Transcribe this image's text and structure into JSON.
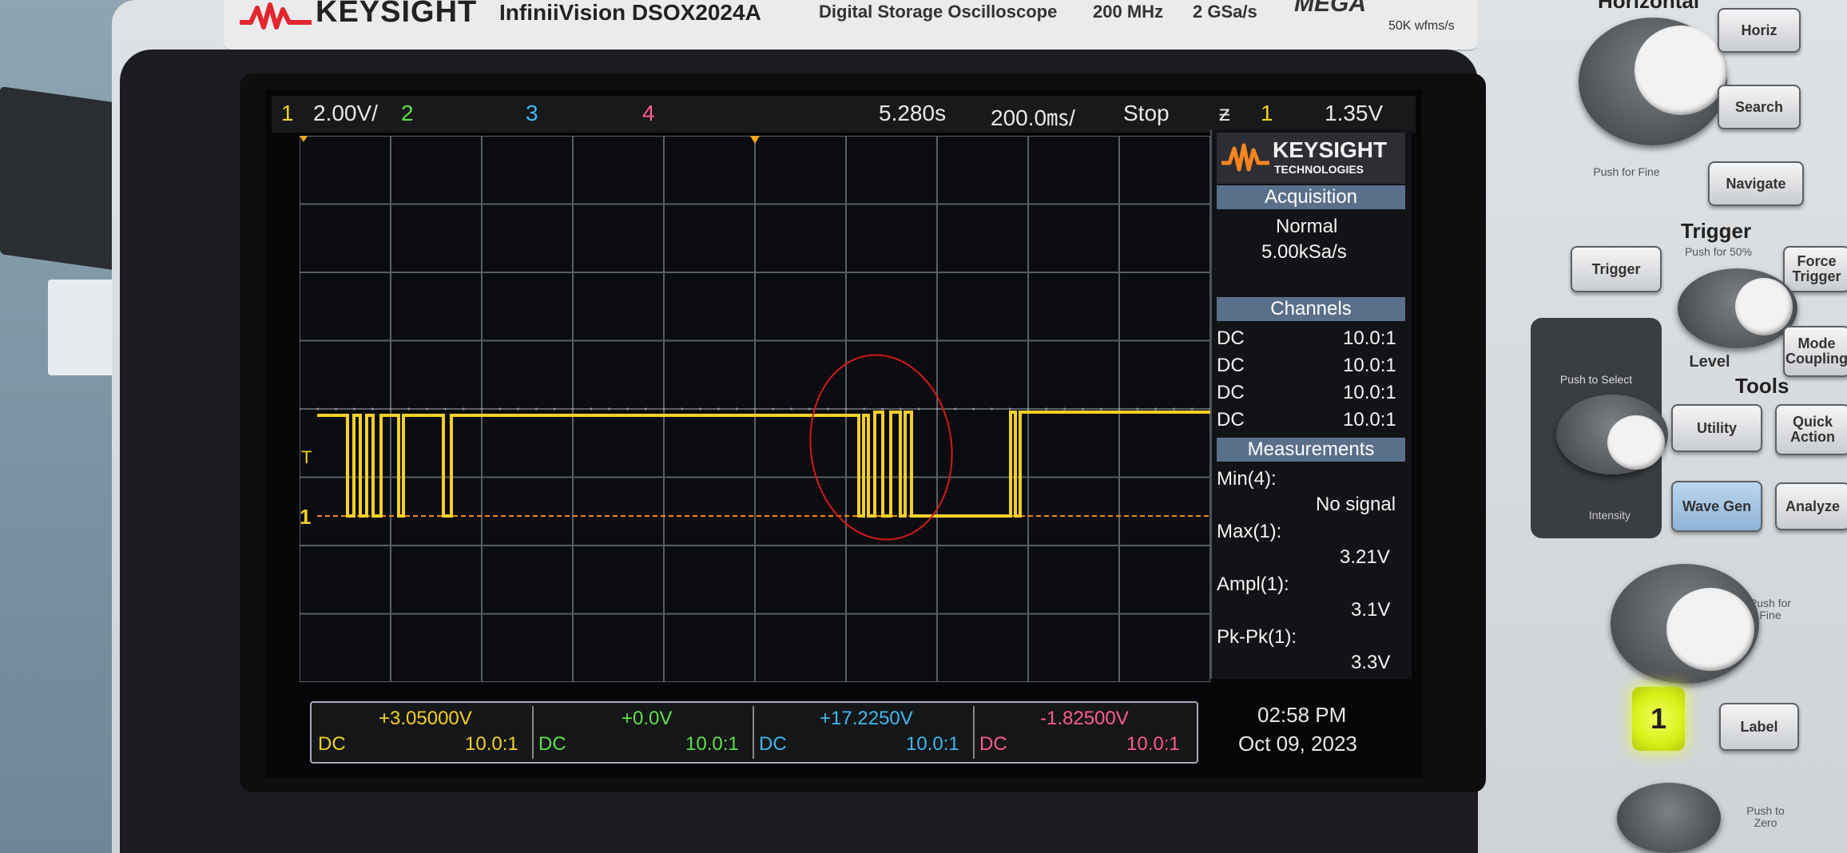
{
  "instrument": {
    "brand": "KEYSIGHT",
    "model": "InfiniiVision DSOX2024A",
    "type": "Digital Storage Oscilloscope",
    "bandwidth": "200 MHz",
    "sample_rate": "2 GSa/s",
    "mega_zoom": "MEGA",
    "wfms": "50K wfms/s"
  },
  "topbar": {
    "ch1_num": "1",
    "ch1_scale": "2.00V/",
    "ch2_num": "2",
    "ch3_num": "3",
    "ch4_num": "4",
    "time_pos": "5.280s",
    "time_scale": "200.0㎳/",
    "run_state": "Stop",
    "trigger_icon": "ƶ",
    "trigger_ch": "1",
    "trigger_level": "1.35V"
  },
  "panel": {
    "logo_line1": "KEYSIGHT",
    "logo_line2": "TECHNOLOGIES",
    "acq_header": "Acquisition",
    "acq_mode": "Normal",
    "acq_rate": "5.00kSa/s",
    "channels_header": "Channels",
    "channels": [
      {
        "coupling": "DC",
        "probe": "10.0:1"
      },
      {
        "coupling": "DC",
        "probe": "10.0:1"
      },
      {
        "coupling": "DC",
        "probe": "10.0:1"
      },
      {
        "coupling": "DC",
        "probe": "10.0:1"
      }
    ],
    "meas_header": "Measurements",
    "measurements": [
      {
        "label": "Min(4):",
        "value": "No signal"
      },
      {
        "label": "Max(1):",
        "value": "3.21V"
      },
      {
        "label": "Ampl(1):",
        "value": "3.1V"
      },
      {
        "label": "Pk-Pk(1):",
        "value": "3.3V"
      }
    ]
  },
  "channel_bar": [
    {
      "offset": "+3.05000V",
      "coupling": "DC",
      "probe": "10.0:1"
    },
    {
      "offset": "+0.0V",
      "coupling": "DC",
      "probe": "10.0:1"
    },
    {
      "offset": "+17.2250V",
      "coupling": "DC",
      "probe": "10.0:1"
    },
    {
      "offset": "-1.82500V",
      "coupling": "DC",
      "probe": "10.0:1"
    }
  ],
  "clock": {
    "time": "02:58 PM",
    "date": "Oct 09, 2023"
  },
  "controls": {
    "horizontal_label": "Horizontal",
    "horiz_btn": "Horiz",
    "search_btn": "Search",
    "navigate_btn": "Navigate",
    "push_fine": "Push for Fine",
    "trigger_section": "Trigger",
    "trigger_btn": "Trigger",
    "push_50": "Push for 50%",
    "force_btn": "Force Trigger",
    "level_label": "Level",
    "mode_btn": "Mode Coupling",
    "tools_section": "Tools",
    "utility_btn": "Utility",
    "quick_btn": "Quick Action",
    "push_select": "Push to Select",
    "intensity": "Intensity",
    "wavegen_btn": "Wave Gen",
    "analyze_btn": "Analyze",
    "push_fine2": "Push for Fine",
    "ch1_btn": "1",
    "label_btn": "Label",
    "push_zero": "Push to Zero"
  },
  "colors": {
    "ch1": "#f2d21f",
    "ch2": "#5ee34a",
    "ch3": "#3fb8f0",
    "ch4": "#ff5c8a",
    "annotation_circle": "#d21a1a"
  }
}
